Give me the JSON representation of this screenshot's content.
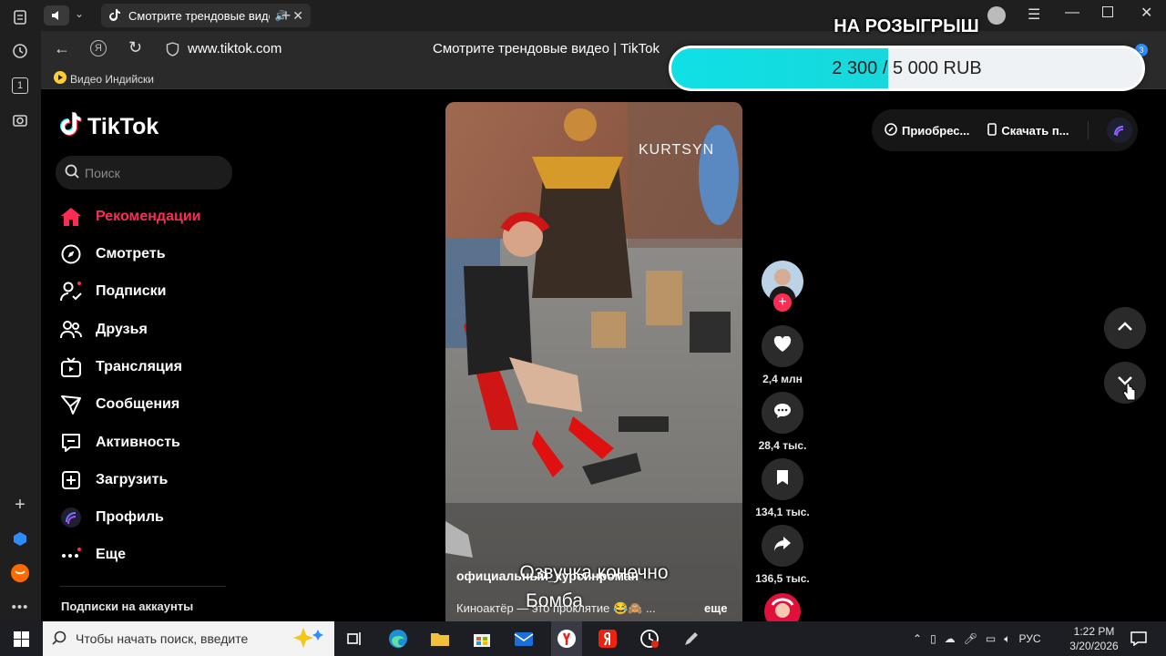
{
  "browser": {
    "tab_title": "Смотрите трендовые видео",
    "url": "www.tiktok.com",
    "page_title": "Смотрите трендовые видео | TikTok",
    "bookmark_label": "Видео Индийски",
    "rail_badge": "1",
    "download_badge": "3"
  },
  "donation": {
    "title": "НА РОЗЫГРЫШ",
    "text": "2 300 / 5 000 RUB",
    "raised": 2300,
    "goal": 5000
  },
  "sidebar": {
    "logo": "TikTok",
    "search_placeholder": "Поиск",
    "items": [
      {
        "label": "Рекомендации",
        "icon": "home-icon",
        "active": true
      },
      {
        "label": "Смотреть",
        "icon": "compass-icon"
      },
      {
        "label": "Подписки",
        "icon": "following-icon"
      },
      {
        "label": "Друзья",
        "icon": "friends-icon"
      },
      {
        "label": "Трансляция",
        "icon": "live-icon"
      },
      {
        "label": "Сообщения",
        "icon": "messages-icon"
      },
      {
        "label": "Активность",
        "icon": "activity-icon"
      },
      {
        "label": "Загрузить",
        "icon": "upload-icon"
      },
      {
        "label": "Профиль",
        "icon": "profile-icon"
      },
      {
        "label": "Еще",
        "icon": "more-icon"
      }
    ],
    "following_accounts": "Подписки на аккаунты"
  },
  "top_actions": {
    "get_coins": "Приобрес...",
    "download_app": "Скачать п..."
  },
  "video": {
    "watermark": "KURTSYN",
    "caption_overlay_line1": "Озвучка конечно",
    "caption_overlay_line2": "Бомба",
    "author": "официальный_курсинроман",
    "description": "Киноактёр — это проклятие 😂🙈 ...",
    "more": "еще"
  },
  "actions": {
    "likes": "2,4 млн",
    "comments": "28,4 тыс.",
    "saves": "134,1 тыс.",
    "shares": "136,5 тыс."
  },
  "taskbar": {
    "search_placeholder": "Чтобы начать поиск, введите",
    "language": "РУС",
    "time": "1:22 PM",
    "date": "3/20/2026"
  },
  "colors": {
    "accent": "#fe2c55",
    "donation_fill": "#12dde1"
  }
}
